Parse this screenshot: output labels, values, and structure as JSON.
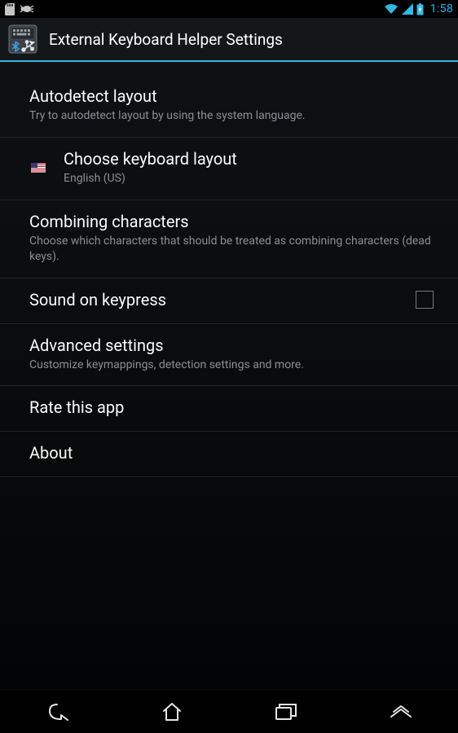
{
  "statusbar": {
    "time": "1:58"
  },
  "actionbar": {
    "title": "External Keyboard Helper Settings"
  },
  "settings": {
    "autodetect": {
      "title": "Autodetect layout",
      "summary": "Try to autodetect layout by using the system language."
    },
    "choose_layout": {
      "title": "Choose keyboard layout",
      "summary": "English (US)"
    },
    "combining": {
      "title": "Combining characters",
      "summary": "Choose which characters that should be treated as combining characters (dead keys)."
    },
    "sound": {
      "title": "Sound on keypress",
      "checked": false
    },
    "advanced": {
      "title": "Advanced settings",
      "summary": "Customize keymappings, detection settings and more."
    },
    "rate": {
      "title": "Rate this app"
    },
    "about": {
      "title": "About"
    }
  }
}
